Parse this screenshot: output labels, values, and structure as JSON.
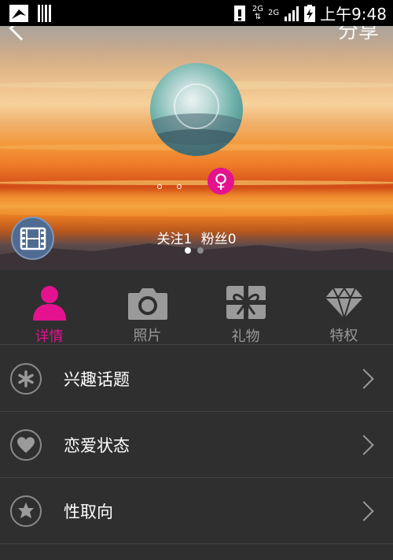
{
  "status_bar": {
    "network_1": "2G",
    "network_2": "2G",
    "time": "上午9:48"
  },
  "header": {
    "top_right_text": "分享"
  },
  "profile": {
    "follow_label": "关注1",
    "fans_label": "粉丝0",
    "gender_symbol": "♀"
  },
  "tabs": [
    {
      "label": "详情",
      "icon": "person-icon",
      "active": true
    },
    {
      "label": "照片",
      "icon": "camera-icon",
      "active": false
    },
    {
      "label": "礼物",
      "icon": "gift-icon",
      "active": false
    },
    {
      "label": "特权",
      "icon": "diamond-icon",
      "active": false
    }
  ],
  "list": [
    {
      "label": "兴趣话题",
      "icon": "asterisk-icon"
    },
    {
      "label": "恋爱状态",
      "icon": "heart-icon"
    },
    {
      "label": "性取向",
      "icon": "star-icon"
    }
  ],
  "colors": {
    "accent": "#e4128f",
    "background": "#2f2f2f",
    "inactive": "#9a9a9a"
  }
}
